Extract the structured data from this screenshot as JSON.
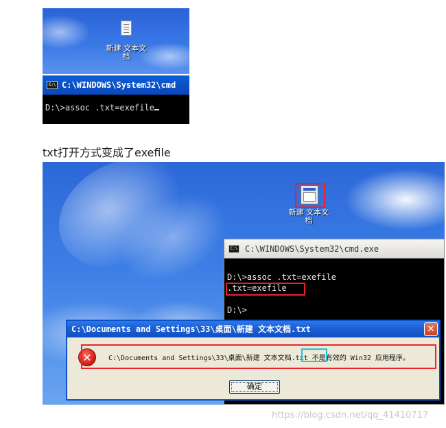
{
  "shot1": {
    "desktop_icon_label_line1": "新建 文本文",
    "desktop_icon_label_line2": "档",
    "icon": "text-document-icon",
    "cmd_title": "C:\\WINDOWS\\System32\\cmd",
    "cmd_title_icon": "C:\\",
    "cmd_line": "D:\\>assoc .txt=exefile"
  },
  "caption": "txt打开方式变成了exefile",
  "shot2": {
    "desktop_icon_label_line1": "新建 文本文",
    "desktop_icon_label_line2": "档",
    "desktop_icon": "exe-program-icon",
    "cmd_title": "C:\\WINDOWS\\System32\\cmd.exe",
    "cmd_title_icon": "C:\\",
    "cmd_lines": [
      "D:\\>assoc .txt=exefile",
      ".txt=exefile",
      "D:\\>"
    ],
    "dialog": {
      "title": "C:\\Documents and Settings\\33\\桌面\\新建 文本文档.txt",
      "close_label": "✕",
      "error_icon": "error-icon",
      "message_pre": "C:\\Documents and Settings\\33\\桌面\\新建 文本文档",
      "message_ext": ".txt",
      "message_post": " 不是有效的 Win32 应用程序。",
      "ok_label": "确定"
    },
    "highlight_colors": {
      "red": "#e8232d",
      "cyan": "#18c6d6"
    }
  },
  "watermark": "https://blog.csdn.net/qq_41410717"
}
